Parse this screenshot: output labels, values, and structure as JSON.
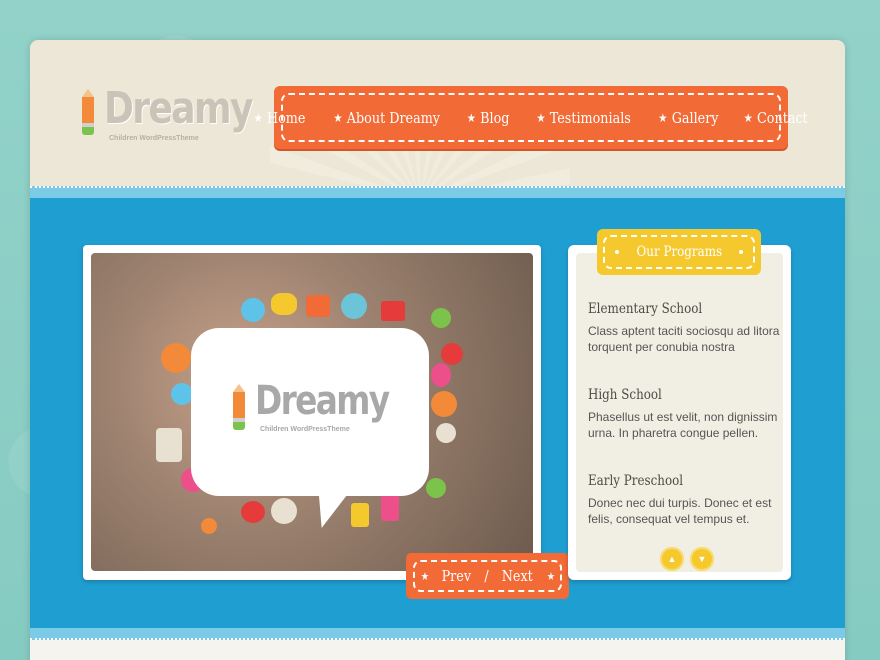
{
  "header": {
    "logo": {
      "title": "Dreamy",
      "subtitle": "Children WordPressTheme"
    },
    "nav": [
      {
        "label": "Home"
      },
      {
        "label": "About Dreamy"
      },
      {
        "label": "Blog"
      },
      {
        "label": "Testimonials"
      },
      {
        "label": "Gallery"
      },
      {
        "label": "Contact"
      }
    ]
  },
  "slider": {
    "logo": {
      "title": "Dreamy",
      "subtitle": "Children WordPressTheme"
    },
    "prev_label": "Prev",
    "separator": "/",
    "next_label": "Next"
  },
  "programs": {
    "title": "Our Programs",
    "items": [
      {
        "title": "Elementary School",
        "desc": "Class aptent taciti sociosqu ad litora torquent per conubia nostra"
      },
      {
        "title": "High School",
        "desc": "Phasellus ut est velit, non dignissim urna. In pharetra congue pellen."
      },
      {
        "title": "Early Preschool",
        "desc": "Donec nec dui turpis. Donec et est felis, consequat vel tempus et."
      }
    ]
  },
  "icons": {
    "nav_star": "★",
    "arrow_up": "▲",
    "arrow_down": "▼"
  },
  "colors": {
    "accent_orange": "#f26a36",
    "accent_yellow": "#f5c92e",
    "main_blue": "#1f9ed1",
    "header_beige": "#ece7d6"
  }
}
